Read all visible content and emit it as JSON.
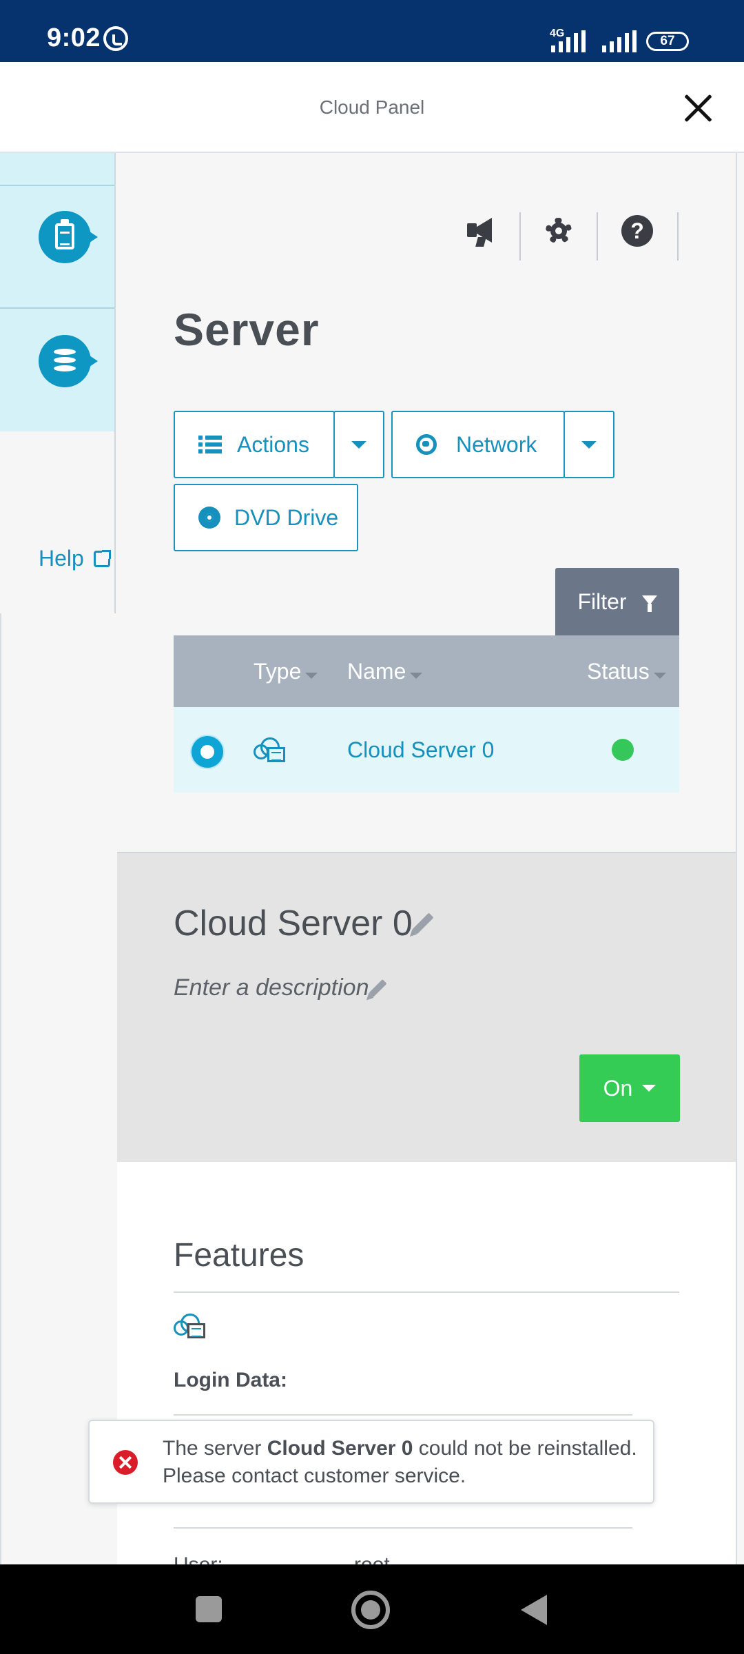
{
  "status_bar": {
    "time": "9:02",
    "network": "4G",
    "battery": "67"
  },
  "header": {
    "title": "Cloud Panel"
  },
  "sidebar": {
    "help_label": "Help"
  },
  "page": {
    "title": "Server"
  },
  "toolbar": {
    "actions_label": "Actions",
    "network_label": "Network",
    "dvd_label": "DVD Drive",
    "filter_label": "Filter"
  },
  "table": {
    "columns": [
      "Type",
      "Name",
      "Status"
    ],
    "rows": [
      {
        "name": "Cloud Server 0",
        "status_color": "#35c75a"
      }
    ]
  },
  "detail": {
    "name": "Cloud Server 0",
    "description_placeholder": "Enter a description",
    "power_label": "On"
  },
  "features": {
    "title": "Features",
    "login_label": "Login Data:",
    "user_label": "User:",
    "user_value": "root"
  },
  "toast": {
    "prefix": "The server ",
    "server_name": "Cloud Server 0",
    "suffix": " could not be reinstalled. Please contact customer service."
  },
  "colors": {
    "accent": "#1690bd",
    "status_bar": "#06326e",
    "power_on": "#34cc55",
    "error": "#d91e2a"
  }
}
